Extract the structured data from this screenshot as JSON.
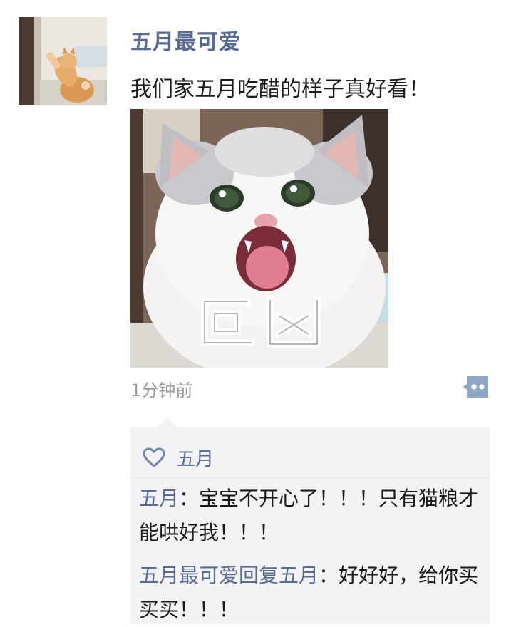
{
  "post": {
    "username": "五月最可爱",
    "text": "我们家五月吃醋的样子真好看！",
    "image_caption": "巨凶",
    "time": "1分钟前"
  },
  "likes": {
    "names": "五月"
  },
  "comments": [
    {
      "author": "五月",
      "separator": "：",
      "text": "宝宝不开心了！！！只有猫粮才能哄好我！！！"
    },
    {
      "author": "五月最可爱",
      "reply_word": "回复",
      "reply_to": "五月",
      "separator": "：",
      "text": "好好好，给你买买买！！！"
    }
  ],
  "colors": {
    "link": "#576b95",
    "comment_bg": "#f3f3f5",
    "time": "#9a9a9a"
  },
  "icons": [
    "heart-icon",
    "more-dots-icon"
  ]
}
